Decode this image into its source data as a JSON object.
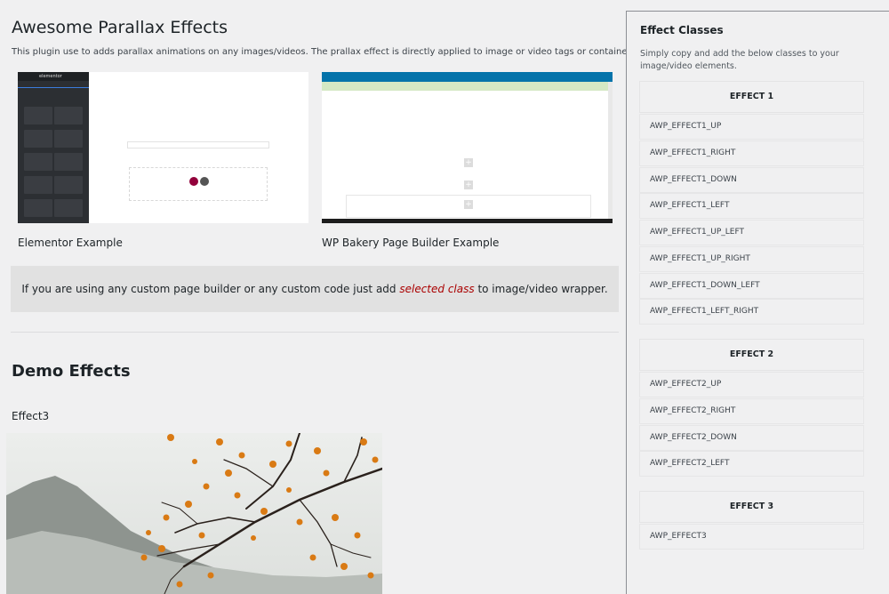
{
  "main": {
    "title": "Awesome Parallax Effects",
    "description": "This plugin use to adds parallax animations on any images/videos. The prallax effect is directly applied to image or video tags or containers",
    "examples": [
      {
        "caption": "Elementor Example",
        "logo_text": "elementor"
      },
      {
        "caption": "WP Bakery Page Builder Example"
      }
    ],
    "notice": {
      "before": "If you are using any custom page builder or any custom code just add ",
      "highlight": "selected class",
      "after": " to image/video wrapper."
    },
    "demo_title": "Demo Effects",
    "effect_label": "Effect3"
  },
  "sidebar": {
    "title": "Effect Classes",
    "description": "Simply copy and add the below classes to your image/video elements.",
    "groups": [
      {
        "heading": "EFFECT 1",
        "classes": [
          "AWP_EFFECT1_UP",
          "AWP_EFFECT1_RIGHT",
          "AWP_EFFECT1_DOWN",
          "AWP_EFFECT1_LEFT",
          "AWP_EFFECT1_UP_LEFT",
          "AWP_EFFECT1_UP_RIGHT",
          "AWP_EFFECT1_DOWN_LEFT",
          "AWP_EFFECT1_LEFT_RIGHT"
        ]
      },
      {
        "heading": "EFFECT 2",
        "classes": [
          "AWP_EFFECT2_UP",
          "AWP_EFFECT2_RIGHT",
          "AWP_EFFECT2_DOWN",
          "AWP_EFFECT2_LEFT"
        ]
      },
      {
        "heading": "EFFECT 3",
        "classes": [
          "AWP_EFFECT3"
        ]
      }
    ]
  },
  "colors": {
    "background": "#f0f0f1",
    "highlight": "#aa0000",
    "wp_bakery_bar": "#0473aa",
    "elementor_dark": "#2c2f33"
  }
}
